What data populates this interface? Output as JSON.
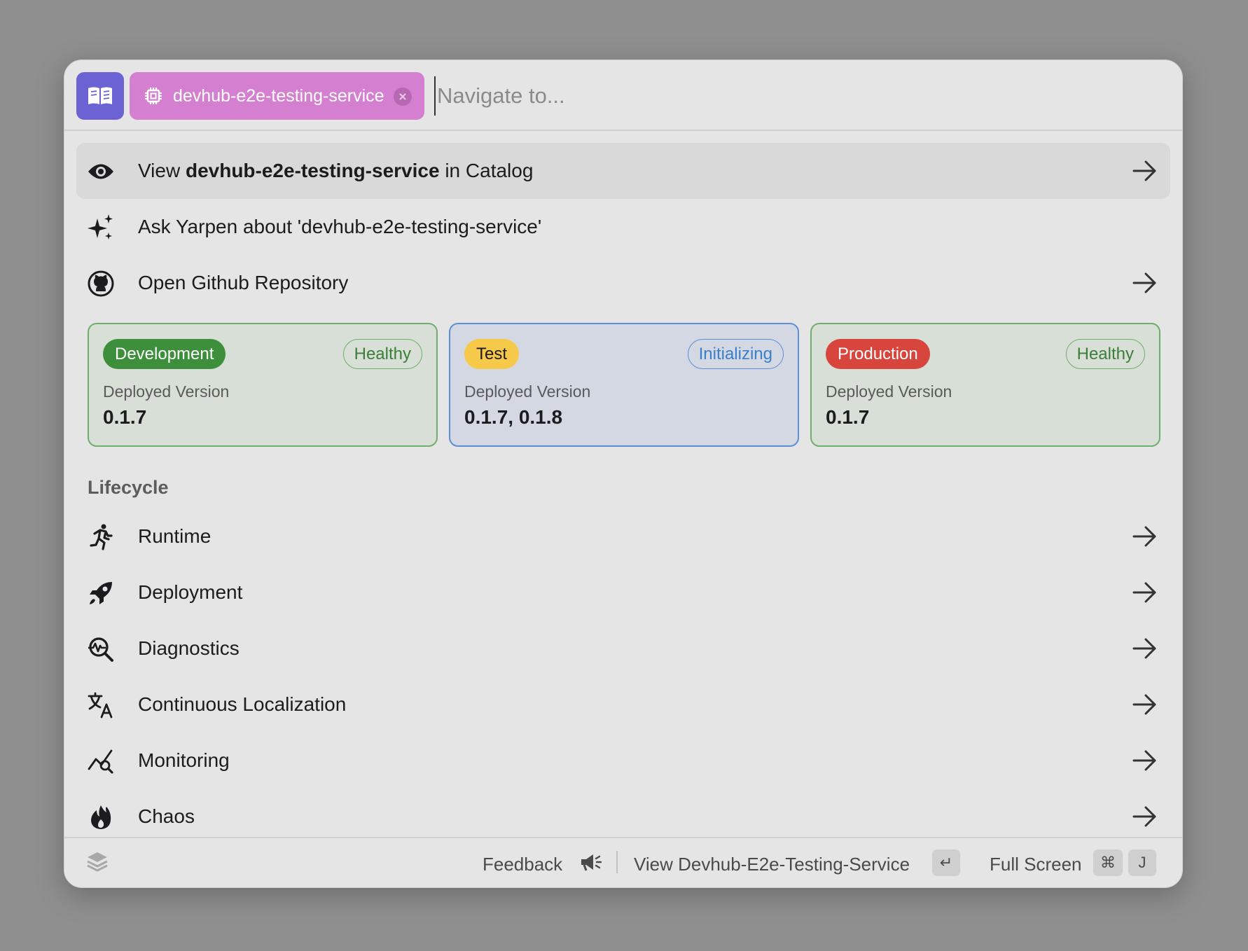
{
  "header": {
    "entity_chip": {
      "label": "devhub-e2e-testing-service",
      "icon": "chip-icon"
    },
    "search_placeholder": "Navigate to...",
    "search_value": ""
  },
  "actions": {
    "view_catalog": {
      "prefix": "View ",
      "entity": "devhub-e2e-testing-service",
      "suffix": " in Catalog",
      "icon": "eye-icon"
    },
    "ask": {
      "label": "Ask Yarpen about 'devhub-e2e-testing-service'",
      "icon": "sparkles-icon"
    },
    "github": {
      "label": "Open Github Repository",
      "icon": "github-icon"
    }
  },
  "environments": [
    {
      "name": "Development",
      "status": "Healthy",
      "deployed_label": "Deployed Version",
      "version": "0.1.7",
      "badge_color": "#3e8f3b"
    },
    {
      "name": "Test",
      "status": "Initializing",
      "deployed_label": "Deployed Version",
      "version": "0.1.7, 0.1.8",
      "badge_color": "#f6c94a"
    },
    {
      "name": "Production",
      "status": "Healthy",
      "deployed_label": "Deployed Version",
      "version": "0.1.7",
      "badge_color": "#d8453d"
    }
  ],
  "lifecycle": {
    "title": "Lifecycle",
    "items": [
      {
        "label": "Runtime",
        "icon": "running-icon"
      },
      {
        "label": "Deployment",
        "icon": "rocket-icon"
      },
      {
        "label": "Diagnostics",
        "icon": "diagnostics-icon"
      },
      {
        "label": "Continuous Localization",
        "icon": "translate-icon"
      },
      {
        "label": "Monitoring",
        "icon": "monitoring-icon"
      },
      {
        "label": "Chaos",
        "icon": "fire-icon"
      }
    ]
  },
  "footer": {
    "feedback": "Feedback",
    "view_label": "View Devhub-E2e-Testing-Service",
    "enter_key": "↵",
    "fullscreen": "Full Screen",
    "cmd_key": "⌘",
    "j_key": "J"
  },
  "colors": {
    "accent_book": "#6b63d4",
    "chip": "#d47fcf",
    "healthy": "#3b7d39",
    "initializing": "#3a7fcb"
  }
}
